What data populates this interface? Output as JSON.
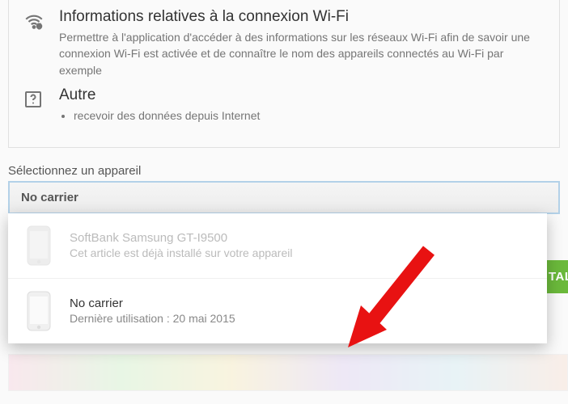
{
  "permissions": {
    "wifi": {
      "title": "Informations relatives à la connexion Wi-Fi",
      "description": "Permettre à l'application d'accéder à des informations sur les réseaux Wi-Fi afin de savoir une connexion Wi-Fi est activée et de connaître le nom des appareils connectés au Wi-Fi par exemple"
    },
    "other": {
      "title": "Autre",
      "bullet": "recevoir des données depuis Internet"
    }
  },
  "device_selector": {
    "label": "Sélectionnez un appareil",
    "selected": "No carrier",
    "options": [
      {
        "name": "SoftBank Samsung GT-I9500",
        "subtitle": "Cet article est déjà installé sur votre appareil",
        "disabled": true
      },
      {
        "name": "No carrier",
        "subtitle": "Dernière utilisation : 20 mai 2015",
        "disabled": false
      }
    ]
  },
  "install_button": "TAL"
}
